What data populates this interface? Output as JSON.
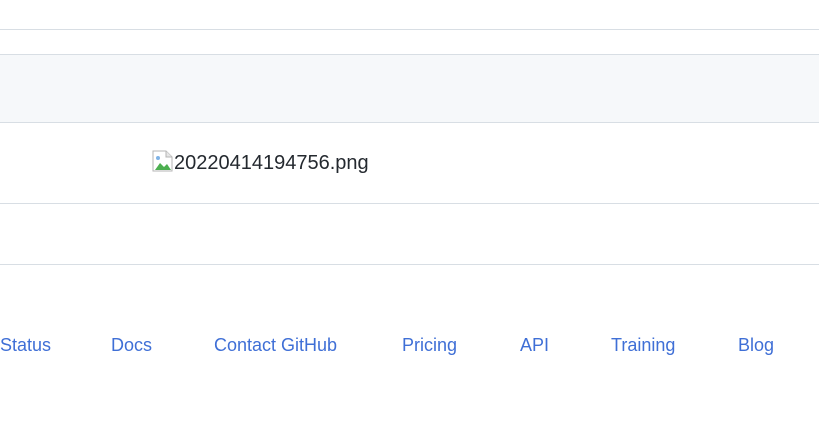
{
  "content": {
    "image": {
      "alt_text": "20220414194756.png",
      "icon": "broken-image-icon"
    }
  },
  "footer": {
    "links": [
      {
        "label": "Status"
      },
      {
        "label": "Docs"
      },
      {
        "label": "Contact GitHub"
      },
      {
        "label": "Pricing"
      },
      {
        "label": "API"
      },
      {
        "label": "Training"
      },
      {
        "label": "Blog"
      }
    ]
  },
  "colors": {
    "link": "#3f6fd6",
    "divider": "#d8dee4",
    "band": "#f6f8fa"
  }
}
